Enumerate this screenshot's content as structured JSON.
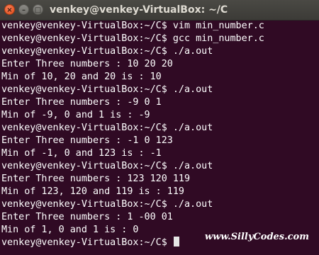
{
  "window": {
    "title": "venkey@venkey-VirtualBox: ~/C",
    "close_glyph": "×",
    "minimize_glyph": "–",
    "maximize_glyph": "□"
  },
  "terminal": {
    "lines": [
      "venkey@venkey-VirtualBox:~/C$ vim min_number.c",
      "venkey@venkey-VirtualBox:~/C$ gcc min_number.c",
      "venkey@venkey-VirtualBox:~/C$ ./a.out",
      "Enter Three numbers : 10 20 20",
      "Min of 10, 20 and 20 is : 10",
      "venkey@venkey-VirtualBox:~/C$ ./a.out",
      "Enter Three numbers : -9 0 1",
      "Min of -9, 0 and 1 is : -9",
      "venkey@venkey-VirtualBox:~/C$ ./a.out",
      "Enter Three numbers : -1 0 123",
      "Min of -1, 0 and 123 is : -1",
      "venkey@venkey-VirtualBox:~/C$ ./a.out",
      "Enter Three numbers : 123 120 119",
      "Min of 123, 120 and 119 is : 119",
      "venkey@venkey-VirtualBox:~/C$ ./a.out",
      "Enter Three numbers : 1 -00 01",
      "Min of 1, 0 and 1 is : 0",
      "venkey@venkey-VirtualBox:~/C$ "
    ]
  },
  "watermark": {
    "text": "www.SillyCodes.com"
  },
  "colors": {
    "terminal_bg": "#300a24",
    "terminal_fg": "#ffffff",
    "close_button": "#df4a16",
    "titlebar_bg": "#3c3b37"
  }
}
